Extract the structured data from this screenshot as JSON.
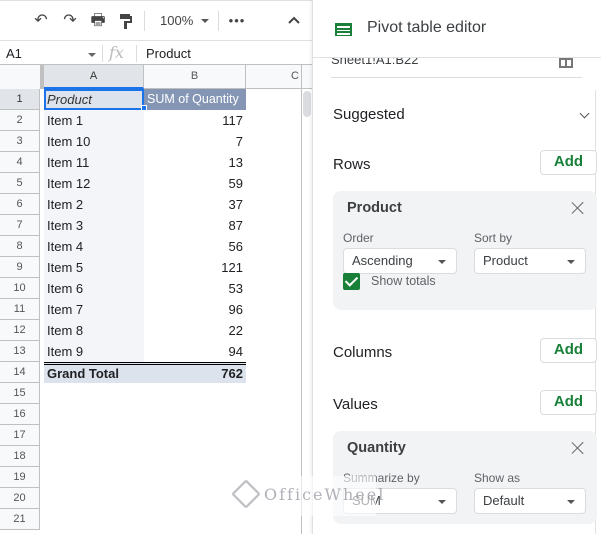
{
  "toolbar": {
    "undo_icon": "undo-icon",
    "redo_icon": "redo-icon",
    "print_icon": "print-icon",
    "paint_format_icon": "paint-format-icon",
    "zoom": "100%",
    "more_icon": "more-horiz-icon",
    "collapse_icon": "chevron-up-icon"
  },
  "formula_bar": {
    "name_box": "A1",
    "fx_label": "fx",
    "content": "Product"
  },
  "columns": [
    "A",
    "B",
    "C"
  ],
  "sheet": {
    "header": {
      "a": "Product",
      "b": "SUM of Quantity"
    },
    "rows": [
      {
        "row": "2",
        "product": "Item 1",
        "quantity": "117"
      },
      {
        "row": "3",
        "product": "Item 10",
        "quantity": "7"
      },
      {
        "row": "4",
        "product": "Item 11",
        "quantity": "13"
      },
      {
        "row": "5",
        "product": "Item 12",
        "quantity": "59"
      },
      {
        "row": "6",
        "product": "Item 2",
        "quantity": "37"
      },
      {
        "row": "7",
        "product": "Item 3",
        "quantity": "87"
      },
      {
        "row": "8",
        "product": "Item 4",
        "quantity": "56"
      },
      {
        "row": "9",
        "product": "Item 5",
        "quantity": "121"
      },
      {
        "row": "10",
        "product": "Item 6",
        "quantity": "53"
      },
      {
        "row": "11",
        "product": "Item 7",
        "quantity": "96"
      },
      {
        "row": "12",
        "product": "Item 8",
        "quantity": "22"
      },
      {
        "row": "13",
        "product": "Item 9",
        "quantity": "94"
      }
    ],
    "total": {
      "row": "14",
      "label": "Grand Total",
      "value": "762"
    },
    "empty_rows": [
      "15",
      "16",
      "17",
      "18",
      "19",
      "20",
      "21"
    ]
  },
  "editor": {
    "title": "Pivot table editor",
    "range": "Sheet1!A1:B22",
    "suggested_label": "Suggested",
    "rows": {
      "label": "Rows",
      "add_label": "Add",
      "field": {
        "name": "Product",
        "order_label": "Order",
        "order_value": "Ascending",
        "sort_by_label": "Sort by",
        "sort_by_value": "Product",
        "show_totals_label": "Show totals",
        "show_totals_checked": true
      }
    },
    "columns": {
      "label": "Columns",
      "add_label": "Add"
    },
    "values": {
      "label": "Values",
      "add_label": "Add",
      "field": {
        "name": "Quantity",
        "summarize_label": "Summarize by",
        "summarize_value": "SUM",
        "show_as_label": "Show as",
        "show_as_value": "Default"
      }
    },
    "accent_color": "#188038"
  },
  "watermark": {
    "text": "OfficeWheel"
  }
}
